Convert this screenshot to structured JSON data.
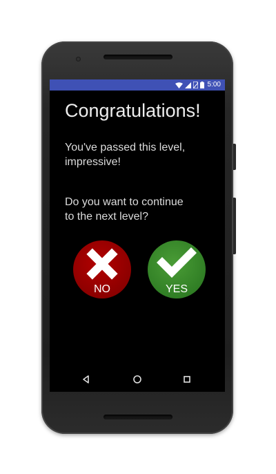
{
  "status_bar": {
    "time": "5:00",
    "icons": [
      "wifi-icon",
      "cell-signal-icon",
      "no-sim-icon",
      "battery-icon"
    ],
    "color": "#3f51b5"
  },
  "dialog": {
    "title": "Congratulations!",
    "message_line1": "You've passed this level,",
    "message_line2": "impressive!",
    "question_line1": "Do you want to continue",
    "question_line2": "to the next level?"
  },
  "buttons": {
    "no": {
      "label": "NO",
      "icon": "cross-icon",
      "color": "#990000"
    },
    "yes": {
      "label": "YES",
      "icon": "checkmark-icon",
      "color": "#3d8c2e"
    }
  },
  "nav_bar": {
    "back": "back-triangle-icon",
    "home": "home-circle-icon",
    "recents": "recents-square-icon"
  }
}
